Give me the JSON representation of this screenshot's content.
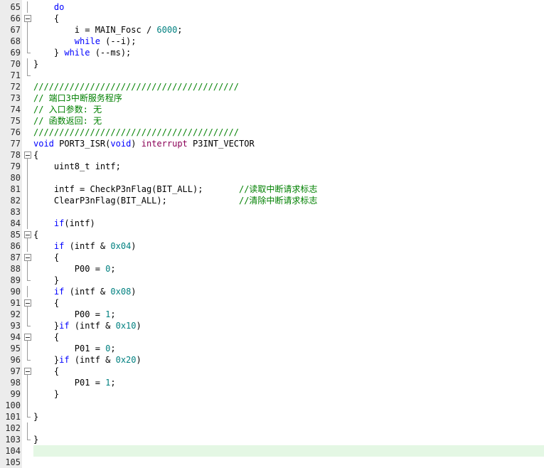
{
  "editor": {
    "current_line": 104,
    "colors": {
      "keyword": "#0000ff",
      "number": "#008080",
      "comment": "#008000",
      "interrupt": "#8b0057",
      "current_line_bg": "#e4f7e4"
    },
    "lines": [
      {
        "n": 65,
        "fold": "line",
        "segs": [
          {
            "t": "    "
          },
          {
            "t": "do",
            "c": "kw"
          }
        ]
      },
      {
        "n": 66,
        "fold": "open",
        "segs": [
          {
            "t": "    {"
          }
        ]
      },
      {
        "n": 67,
        "fold": "line",
        "segs": [
          {
            "t": "        i = MAIN_Fosc / "
          },
          {
            "t": "6000",
            "c": "num"
          },
          {
            "t": ";"
          }
        ]
      },
      {
        "n": 68,
        "fold": "line",
        "segs": [
          {
            "t": "        "
          },
          {
            "t": "while",
            "c": "kw"
          },
          {
            "t": " (--i);"
          }
        ]
      },
      {
        "n": 69,
        "fold": "end",
        "segs": [
          {
            "t": "    } "
          },
          {
            "t": "while",
            "c": "kw"
          },
          {
            "t": " (--ms);"
          }
        ]
      },
      {
        "n": 70,
        "fold": "line",
        "segs": [
          {
            "t": "}"
          }
        ]
      },
      {
        "n": 71,
        "fold": "end",
        "segs": []
      },
      {
        "n": 72,
        "fold": "none",
        "segs": [
          {
            "t": "////////////////////////////////////////",
            "c": "cm"
          }
        ]
      },
      {
        "n": 73,
        "fold": "none",
        "segs": [
          {
            "t": "// 端口3中断服务程序",
            "c": "cm"
          }
        ]
      },
      {
        "n": 74,
        "fold": "none",
        "segs": [
          {
            "t": "// 入口参数: 无",
            "c": "cm"
          }
        ]
      },
      {
        "n": 75,
        "fold": "none",
        "segs": [
          {
            "t": "// 函数返回: 无",
            "c": "cm"
          }
        ]
      },
      {
        "n": 76,
        "fold": "none",
        "segs": [
          {
            "t": "////////////////////////////////////////",
            "c": "cm"
          }
        ]
      },
      {
        "n": 77,
        "fold": "none",
        "segs": [
          {
            "t": "void",
            "c": "kw"
          },
          {
            "t": " PORT3_ISR("
          },
          {
            "t": "void",
            "c": "kw"
          },
          {
            "t": ") "
          },
          {
            "t": "interrupt",
            "c": "ir"
          },
          {
            "t": " P3INT_VECTOR"
          }
        ]
      },
      {
        "n": 78,
        "fold": "open",
        "segs": [
          {
            "t": "{"
          }
        ]
      },
      {
        "n": 79,
        "fold": "line",
        "segs": [
          {
            "t": "    uint8_t intf;"
          }
        ]
      },
      {
        "n": 80,
        "fold": "line",
        "segs": []
      },
      {
        "n": 81,
        "fold": "line",
        "segs": [
          {
            "t": "    intf = CheckP3nFlag(BIT_ALL);       "
          },
          {
            "t": "//读取中断请求标志",
            "c": "cm"
          }
        ]
      },
      {
        "n": 82,
        "fold": "line",
        "segs": [
          {
            "t": "    ClearP3nFlag(BIT_ALL);              "
          },
          {
            "t": "//清除中断请求标志",
            "c": "cm"
          }
        ]
      },
      {
        "n": 83,
        "fold": "line",
        "segs": []
      },
      {
        "n": 84,
        "fold": "line",
        "segs": [
          {
            "t": "    "
          },
          {
            "t": "if",
            "c": "kw"
          },
          {
            "t": "(intf)"
          }
        ]
      },
      {
        "n": 85,
        "fold": "open",
        "segs": [
          {
            "t": "{"
          }
        ]
      },
      {
        "n": 86,
        "fold": "line",
        "segs": [
          {
            "t": "    "
          },
          {
            "t": "if",
            "c": "kw"
          },
          {
            "t": " (intf & "
          },
          {
            "t": "0x04",
            "c": "num"
          },
          {
            "t": ")"
          }
        ]
      },
      {
        "n": 87,
        "fold": "open",
        "segs": [
          {
            "t": "    {"
          }
        ]
      },
      {
        "n": 88,
        "fold": "line",
        "segs": [
          {
            "t": "        P00 = "
          },
          {
            "t": "0",
            "c": "num"
          },
          {
            "t": ";"
          }
        ]
      },
      {
        "n": 89,
        "fold": "end",
        "segs": [
          {
            "t": "    }"
          }
        ]
      },
      {
        "n": 90,
        "fold": "line",
        "segs": [
          {
            "t": "    "
          },
          {
            "t": "if",
            "c": "kw"
          },
          {
            "t": " (intf & "
          },
          {
            "t": "0x08",
            "c": "num"
          },
          {
            "t": ")"
          }
        ]
      },
      {
        "n": 91,
        "fold": "open",
        "segs": [
          {
            "t": "    {"
          }
        ]
      },
      {
        "n": 92,
        "fold": "line",
        "segs": [
          {
            "t": "        P00 = "
          },
          {
            "t": "1",
            "c": "num"
          },
          {
            "t": ";"
          }
        ]
      },
      {
        "n": 93,
        "fold": "end",
        "segs": [
          {
            "t": "    }"
          },
          {
            "t": "if",
            "c": "kw"
          },
          {
            "t": " (intf & "
          },
          {
            "t": "0x10",
            "c": "num"
          },
          {
            "t": ")"
          }
        ]
      },
      {
        "n": 94,
        "fold": "open",
        "segs": [
          {
            "t": "    {"
          }
        ]
      },
      {
        "n": 95,
        "fold": "line",
        "segs": [
          {
            "t": "        P01 = "
          },
          {
            "t": "0",
            "c": "num"
          },
          {
            "t": ";"
          }
        ]
      },
      {
        "n": 96,
        "fold": "end",
        "segs": [
          {
            "t": "    }"
          },
          {
            "t": "if",
            "c": "kw"
          },
          {
            "t": " (intf & "
          },
          {
            "t": "0x20",
            "c": "num"
          },
          {
            "t": ")"
          }
        ]
      },
      {
        "n": 97,
        "fold": "open",
        "segs": [
          {
            "t": "    {"
          }
        ]
      },
      {
        "n": 98,
        "fold": "line",
        "segs": [
          {
            "t": "        P01 = "
          },
          {
            "t": "1",
            "c": "num"
          },
          {
            "t": ";"
          }
        ]
      },
      {
        "n": 99,
        "fold": "line",
        "segs": [
          {
            "t": "    }"
          }
        ]
      },
      {
        "n": 100,
        "fold": "line",
        "segs": []
      },
      {
        "n": 101,
        "fold": "end",
        "segs": [
          {
            "t": "}"
          }
        ]
      },
      {
        "n": 102,
        "fold": "line",
        "segs": []
      },
      {
        "n": 103,
        "fold": "end",
        "segs": [
          {
            "t": "}"
          }
        ]
      },
      {
        "n": 104,
        "fold": "none",
        "segs": []
      },
      {
        "n": 105,
        "fold": "none",
        "segs": []
      }
    ]
  }
}
